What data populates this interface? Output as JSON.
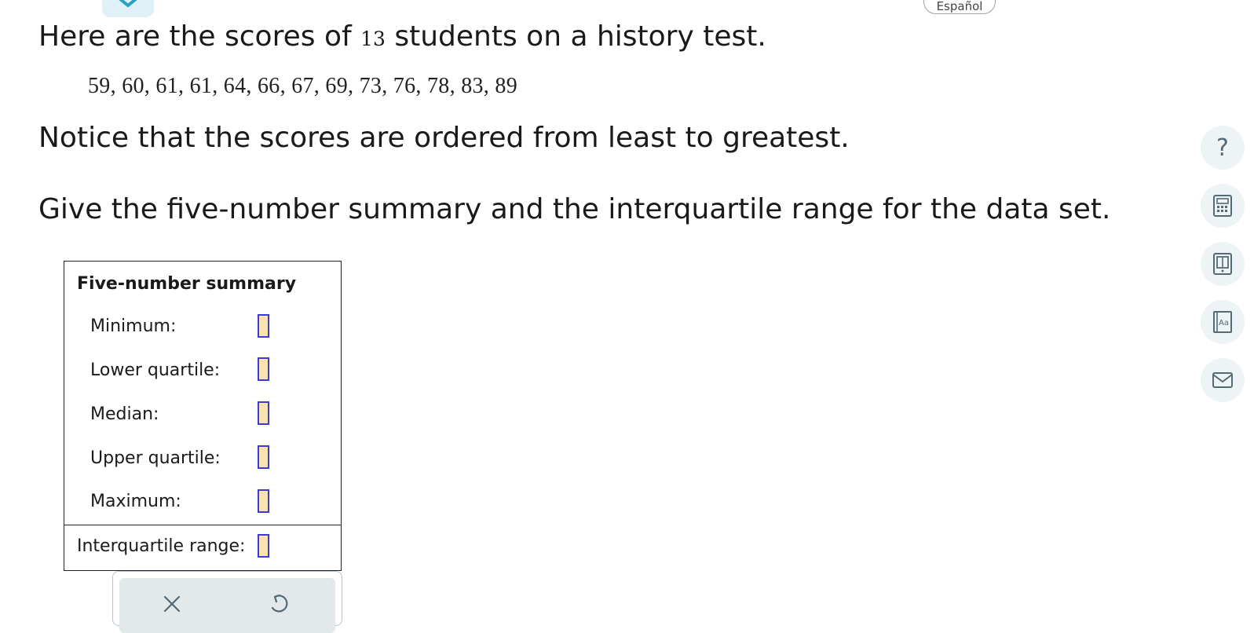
{
  "header": {
    "language_button": "Español"
  },
  "question": {
    "line1_before": "Here are the scores of ",
    "student_count": "13",
    "line1_after": " students on a history test.",
    "data_list": "59,  60,  61,  61,  64,  66,  67,  69,  73,  76,  78,  83,  89",
    "line2": "Notice that the scores are ordered from least to greatest.",
    "line3": "Give the five-number summary and the interquartile range for the data set."
  },
  "summary": {
    "title": "Five-number summary",
    "rows": [
      {
        "label": "Minimum:"
      },
      {
        "label": "Lower quartile:"
      },
      {
        "label": "Median:"
      },
      {
        "label": "Upper quartile:"
      },
      {
        "label": "Maximum:"
      }
    ],
    "iqr_label": "Interquartile range:"
  },
  "actions": {
    "clear_icon": "x-icon",
    "undo_icon": "undo-icon"
  },
  "sidebar": {
    "help_label": "?",
    "icons": [
      "question-icon",
      "calculator-icon",
      "textbook-icon",
      "dictionary-icon",
      "mail-icon"
    ]
  },
  "colors": {
    "answer_fill": "#fbe2b2",
    "answer_border": "#3b3bd6",
    "side_bg": "#eef3f5",
    "accent": "#2aa0c2"
  }
}
